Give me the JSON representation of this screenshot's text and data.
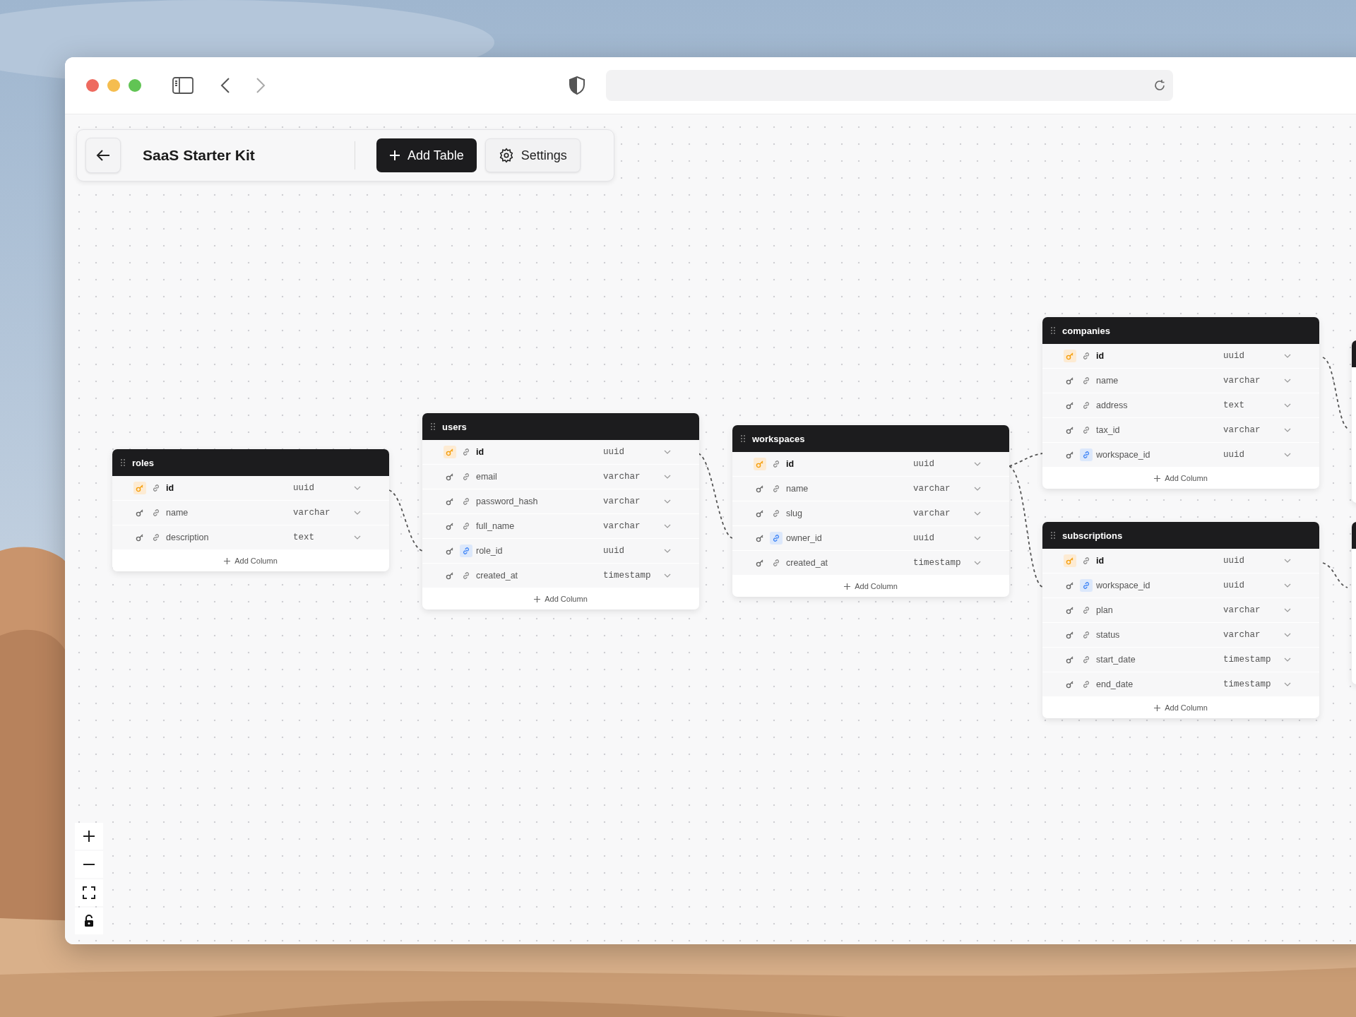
{
  "toolbar": {
    "title": "SaaS Starter Kit",
    "buttons": [
      {
        "label": "Add Table",
        "kind": "primary"
      },
      {
        "label": "Settings",
        "kind": "secondary"
      }
    ]
  },
  "tables": [
    {
      "name": "roles",
      "add_label": "Add Column",
      "columns": [
        {
          "name": "id",
          "type": "uuid",
          "primary_key": true,
          "foreign_key": false
        },
        {
          "name": "name",
          "type": "varchar",
          "primary_key": false,
          "foreign_key": false
        },
        {
          "name": "description",
          "type": "text",
          "primary_key": false,
          "foreign_key": false
        }
      ]
    },
    {
      "name": "users",
      "add_label": "Add Column",
      "columns": [
        {
          "name": "id",
          "type": "uuid",
          "primary_key": true,
          "foreign_key": false
        },
        {
          "name": "email",
          "type": "varchar",
          "primary_key": false,
          "foreign_key": false
        },
        {
          "name": "password_hash",
          "type": "varchar",
          "primary_key": false,
          "foreign_key": false
        },
        {
          "name": "full_name",
          "type": "varchar",
          "primary_key": false,
          "foreign_key": false
        },
        {
          "name": "role_id",
          "type": "uuid",
          "primary_key": false,
          "foreign_key": true
        },
        {
          "name": "created_at",
          "type": "timestamp",
          "primary_key": false,
          "foreign_key": false
        }
      ]
    },
    {
      "name": "workspaces",
      "add_label": "Add Column",
      "columns": [
        {
          "name": "id",
          "type": "uuid",
          "primary_key": true,
          "foreign_key": false
        },
        {
          "name": "name",
          "type": "varchar",
          "primary_key": false,
          "foreign_key": false
        },
        {
          "name": "slug",
          "type": "varchar",
          "primary_key": false,
          "foreign_key": false
        },
        {
          "name": "owner_id",
          "type": "uuid",
          "primary_key": false,
          "foreign_key": true
        },
        {
          "name": "created_at",
          "type": "timestamp",
          "primary_key": false,
          "foreign_key": false
        }
      ]
    },
    {
      "name": "companies",
      "add_label": "Add Column",
      "columns": [
        {
          "name": "id",
          "type": "uuid",
          "primary_key": true,
          "foreign_key": false
        },
        {
          "name": "name",
          "type": "varchar",
          "primary_key": false,
          "foreign_key": false
        },
        {
          "name": "address",
          "type": "text",
          "primary_key": false,
          "foreign_key": false
        },
        {
          "name": "tax_id",
          "type": "varchar",
          "primary_key": false,
          "foreign_key": false
        },
        {
          "name": "workspace_id",
          "type": "uuid",
          "primary_key": false,
          "foreign_key": true
        }
      ]
    },
    {
      "name": "subscriptions",
      "add_label": "Add Column",
      "columns": [
        {
          "name": "id",
          "type": "uuid",
          "primary_key": true,
          "foreign_key": false
        },
        {
          "name": "workspace_id",
          "type": "uuid",
          "primary_key": false,
          "foreign_key": true
        },
        {
          "name": "plan",
          "type": "varchar",
          "primary_key": false,
          "foreign_key": false
        },
        {
          "name": "status",
          "type": "varchar",
          "primary_key": false,
          "foreign_key": false
        },
        {
          "name": "start_date",
          "type": "timestamp",
          "primary_key": false,
          "foreign_key": false
        },
        {
          "name": "end_date",
          "type": "timestamp",
          "primary_key": false,
          "foreign_key": false
        }
      ]
    }
  ]
}
